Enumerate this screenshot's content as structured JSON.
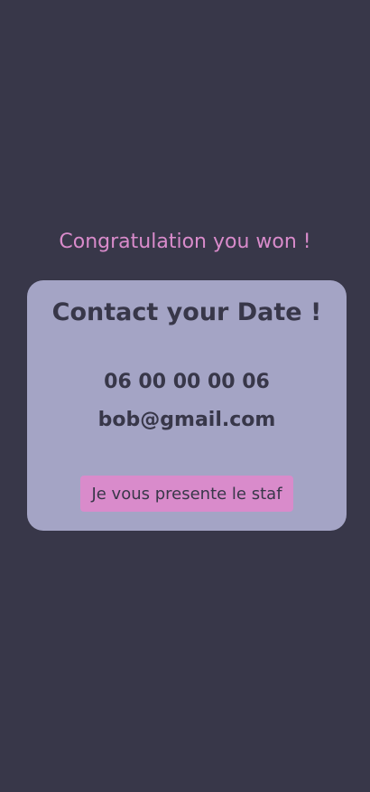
{
  "message": {
    "congratulation": "Congratulation you won !"
  },
  "card": {
    "title": "Contact your Date !",
    "phone": "06 00 00 00 06",
    "email": "bob@gmail.com",
    "button_label": "Je vous presente le staf"
  },
  "colors": {
    "background": "#383749",
    "card": "#a4a4c5",
    "accent": "#d98bcb",
    "text_dark": "#383749"
  }
}
